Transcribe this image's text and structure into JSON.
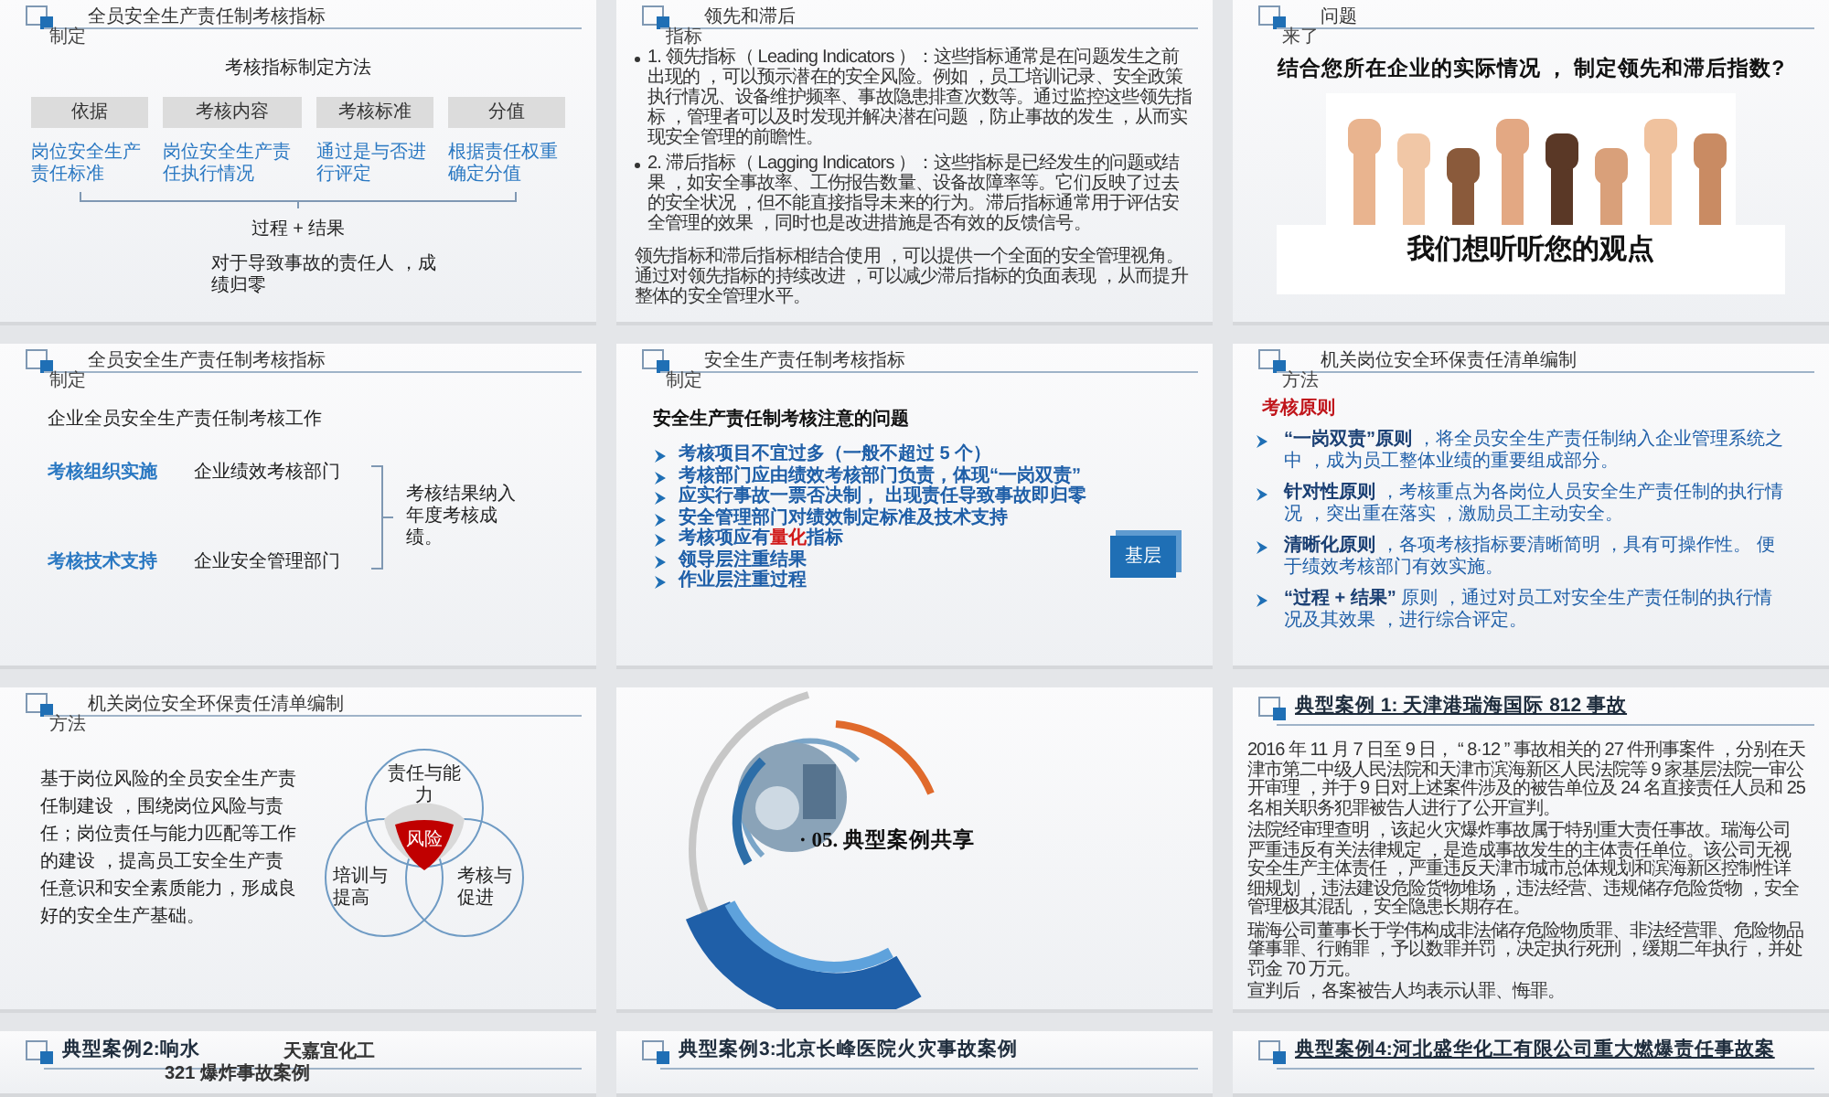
{
  "slides": [
    {
      "kind": "method",
      "header": {
        "title": "全员安全生产责任制考核指标",
        "tag": "制定"
      },
      "heading": "考核指标制定方法",
      "columns": [
        {
          "head": "依据",
          "body": "岗位安全生产责任标准"
        },
        {
          "head": "考核内容",
          "body": "岗位安全生产责任执行情况"
        },
        {
          "head": "考核标准",
          "body": "通过是与否进行评定"
        },
        {
          "head": "分值",
          "body": "根据责任权重确定分值"
        }
      ],
      "summary": "过程 + 结果",
      "note": "对于导致事故的责任人 ，成绩归零"
    },
    {
      "kind": "indicators",
      "header": {
        "title": "领先和滞后",
        "tag": "指标"
      },
      "bullets": [
        "1. 领先指标（ Leading Indicators ）：这些指标通常是在问题发生之前出现的 ，可以预示潜在的安全风险。例如 ，员工培训记录、安全政策执行情况、设备维护频率、事故隐患排查次数等。通过监控这些领先指标 ，管理者可以及时发现并解决潜在问题 ，防止事故的发生 ，从而实现安全管理的前瞻性。",
        "2. 滞后指标（ Lagging Indicators ）：这些指标是已经发生的问题或结果 ，如安全事故率、工伤报告数量、设备故障率等。它们反映了过去的安全状况 ，但不能直接指导未来的行为。滞后指标通常用于评估安全管理的效果 ，同时也是改进措施是否有效的反馈信号。"
      ],
      "summary": "领先指标和滞后指标相结合使用 ，可以提供一个全面的安全管理视角。通过对领先指标的持续改进 ，可以减少滞后指标的负面表现 ，从而提升整体的安全管理水平。"
    },
    {
      "kind": "question",
      "header": {
        "title": "问题",
        "tag": "来了"
      },
      "question": "结合您所在企业的实际情况 ， 制定领先和滞后指数?",
      "caption": "我们想听听您的观点"
    },
    {
      "kind": "org",
      "header": {
        "title": "全员安全生产责任制考核指标",
        "tag": "制定"
      },
      "intro": "企业全员安全生产责任制考核工作",
      "rows": [
        {
          "label": "考核组织实施",
          "dept": "企业绩效考核部门"
        },
        {
          "label": "考核技术支持",
          "dept": "企业安全管理部门"
        }
      ],
      "result": "考核结果纳入年度考核成绩。"
    },
    {
      "kind": "checklist",
      "header": {
        "title": "安全生产责任制考核指标",
        "tag": "制定"
      },
      "heading": "安全生产责任制考核注意的问题",
      "items": [
        "考核项目不宜过多（一般不超过 5 个）",
        "考核部门应由绩效考核部门负责，体现“一岗双责”",
        "应实行事故一票否决制， 出现责任导致事故即归零",
        "安全管理部门对绩效制定标准及技术支持",
        "考核项应有**量化**指标",
        "领导层注重结果",
        "作业层注重过程"
      ],
      "level_tag": "基层"
    },
    {
      "kind": "principles",
      "header": {
        "title": "机关岗位安全环保责任清单编制",
        "tag": "方法"
      },
      "heading": "考核原则",
      "items": [
        "**“一岗双责”原则** ，将全员安全生产责任制纳入企业管理系统之中 ，成为员工整体业绩的重要组成部分。",
        "**针对性原则** ，考核重点为各岗位人员安全生产责任制的执行情况 ，突出重在落实 ，激励员工主动安全。",
        "**清晰化原则** ，各项考核指标要清晰简明 ，具有可操作性。 便于绩效考核部门有效实施。",
        "**“过程 + 结果”** 原则 ，通过对员工对安全生产责任制的执行情况及其效果 ，进行综合评定。"
      ]
    },
    {
      "kind": "venn",
      "header": {
        "title": "机关岗位安全环保责任清单编制",
        "tag": "方法"
      },
      "text": "基于岗位风险的全员安全生产责任制建设 ，围绕岗位风险与责任；岗位责任与能力匹配等工作的建设 ，提高员工安全生产责任意识和安全素质能力，形成良好的安全生产基础。",
      "circles": [
        "责任与能力",
        "培训与提高",
        "考核与促进"
      ],
      "center": "风险"
    },
    {
      "kind": "section",
      "title": "· 05. 典型案例共享"
    },
    {
      "kind": "case",
      "header": {
        "title": "典型案例 1: 天津港瑞海国际 812 事故",
        "underlined": true
      },
      "paragraphs": [
        "2016 年 11 月 7 日至 9 日， “ 8·12 ” 事故相关的 27 件刑事案件 ，分别在天津市第二中级人民法院和天津市滨海新区人民法院等 9 家基层法院一审公开审理 ，并于 9 日对上述案件涉及的被告单位及 24 名直接责任人员和 25 名相关职务犯罪被告人进行了公开宣判。",
        "法院经审理查明 ，该起火灾爆炸事故属于特别重大责任事故。瑞海公司严重违反有关法律规定 ，是造成事故发生的主体责任单位。该公司无视安全生产主体责任 ，严重违反天津市城市总体规划和滨海新区控制性详细规划 ，违法建设危险货物堆场 ，违法经营、违规储存危险货物 ，安全管理极其混乱 ，安全隐患长期存在。",
        "瑞海公司董事长于学伟构成非法储存危险物质罪、非法经营罪、危险物品肇事罪、行贿罪 ，予以数罪并罚 ，决定执行死刑 ，缓期二年执行 ，并处罚金 70 万元。",
        "宣判后 ，各案被告人均表示认罪、悔罪。"
      ]
    },
    {
      "kind": "case",
      "header": {
        "title": "典型案例2:响水",
        "extra": [
          "天嘉宜化工",
          "321 爆炸事故案例"
        ],
        "underlined": false
      }
    },
    {
      "kind": "case",
      "header": {
        "title": "典型案例3:北京长峰医院火灾事故案例",
        "underlined": false
      }
    },
    {
      "kind": "case",
      "header": {
        "title": "典型案例4:河北盛华化工有限公司重大燃爆责任事故案",
        "underlined": true
      }
    }
  ]
}
